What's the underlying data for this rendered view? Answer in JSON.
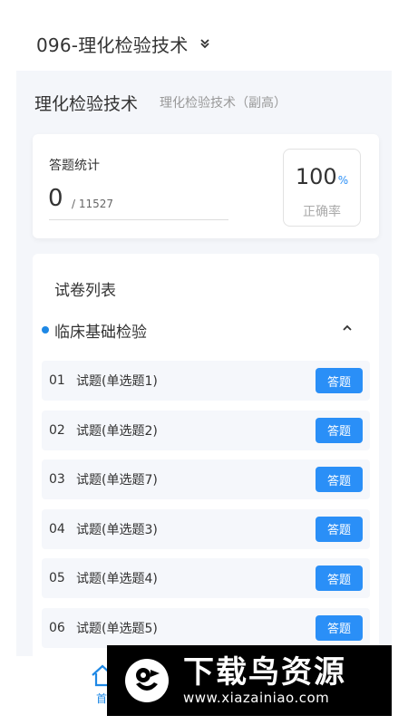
{
  "topbar": {
    "title": "096-理化检验技术"
  },
  "subject": {
    "name": "理化检验技术",
    "sub": "理化检验技术（副高）"
  },
  "stats": {
    "label": "答题统计",
    "count": "0",
    "total": "/ 11527",
    "rate_value": "100",
    "rate_unit": "%",
    "rate_label": "正确率"
  },
  "papers": {
    "title": "试卷列表",
    "section": "临床基础检验",
    "answer_label": "答题",
    "items": [
      {
        "num": "01",
        "name": "试题(单选题1)"
      },
      {
        "num": "02",
        "name": "试题(单选题2)"
      },
      {
        "num": "03",
        "name": "试题(单选题7)"
      },
      {
        "num": "04",
        "name": "试题(单选题3)"
      },
      {
        "num": "05",
        "name": "试题(单选题4)"
      },
      {
        "num": "06",
        "name": "试题(单选题5)"
      }
    ]
  },
  "nav": {
    "home_label": "首"
  },
  "watermark": {
    "brand": "下载鸟资源",
    "url": "www.xiazainiao.com"
  },
  "colors": {
    "accent": "#2a8ff7",
    "dot": "#1e88e5",
    "background": "#f4f6fa"
  }
}
